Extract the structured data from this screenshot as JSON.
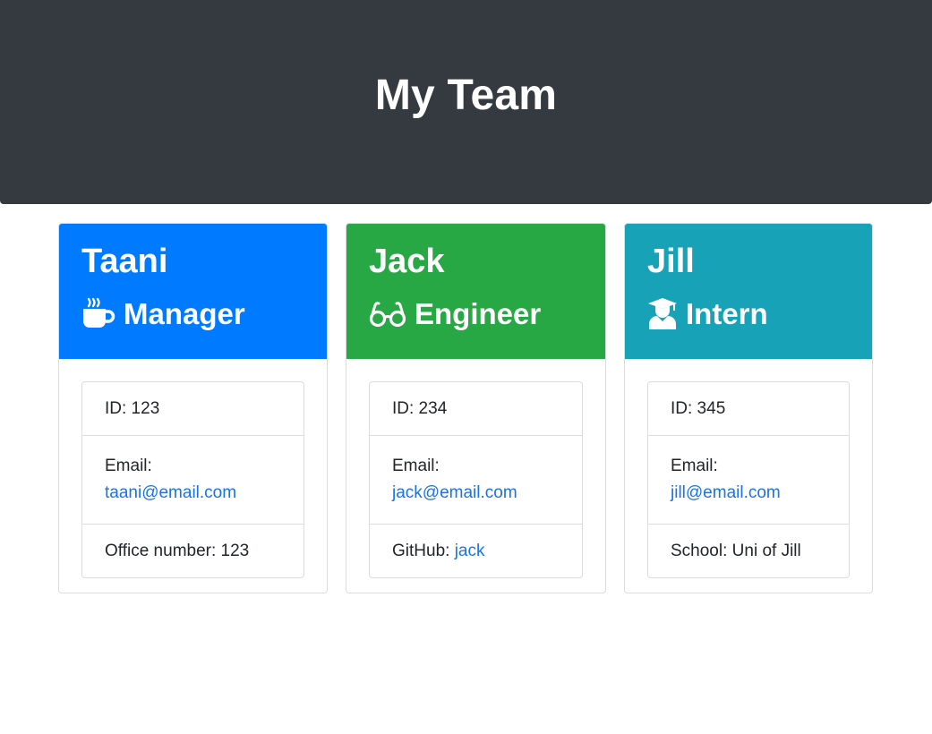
{
  "header": {
    "title": "My Team"
  },
  "colors": {
    "manager": "#007bff",
    "engineer": "#28a745",
    "intern": "#17a2b8",
    "header_bg": "#343a40",
    "link": "#1a73e8"
  },
  "cards": [
    {
      "name": "Taani",
      "role": "Manager",
      "icon": "coffee-mug-icon",
      "id_label": "ID: 123",
      "email_label": "Email:",
      "email": "taani@email.com",
      "extra_label": "Office number: 123",
      "extra_link": ""
    },
    {
      "name": "Jack",
      "role": "Engineer",
      "icon": "glasses-icon",
      "id_label": "ID: 234",
      "email_label": "Email:",
      "email": "jack@email.com",
      "extra_label": "GitHub: ",
      "extra_link": "jack"
    },
    {
      "name": "Jill",
      "role": "Intern",
      "icon": "graduate-icon",
      "id_label": "ID: 345",
      "email_label": "Email:",
      "email": "jill@email.com",
      "extra_label": "School: Uni of Jill",
      "extra_link": ""
    }
  ]
}
